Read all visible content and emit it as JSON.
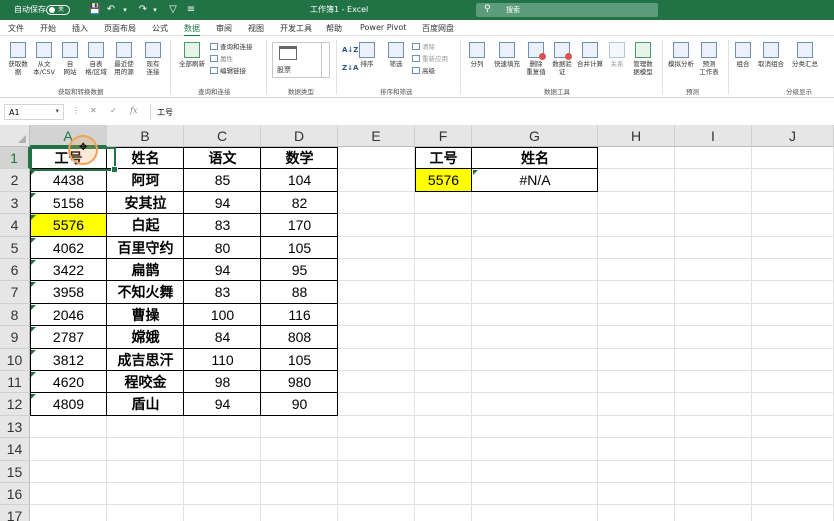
{
  "titlebar": {
    "autosave_label": "自动保存",
    "autosave_state": "关",
    "doc_title": "工作簿1 - Excel",
    "search_placeholder": "搜索",
    "icons": [
      "save-icon",
      "undo-icon",
      "redo-icon",
      "filter-icon",
      "customize-icon"
    ]
  },
  "menu": {
    "tabs": [
      "文件",
      "开始",
      "插入",
      "页面布局",
      "公式",
      "数据",
      "审阅",
      "视图",
      "开发工具",
      "帮助",
      "Power Pivot",
      "百度网盘"
    ],
    "active": "数据"
  },
  "ribbon": {
    "get_data": "获取数\n据",
    "from_text_csv": "从文\n本/CSV",
    "from_web": "自\n网站",
    "from_table": "自表\n格/区域",
    "recent_sources": "最近使\n用的源",
    "existing_conn": "现有\n连接",
    "group_get_transform": "获取和转换数据",
    "refresh_all": "全部刷新",
    "queries_conn": "查询和连接",
    "properties": "属性",
    "edit_links": "编辑链接",
    "group_queries": "查询和连接",
    "stock": "股票",
    "group_datatypes": "数据类型",
    "sort": "排序",
    "filter": "筛选",
    "clear": "清除",
    "reapply": "重新应用",
    "advanced": "高级",
    "group_sort_filter": "排序和筛选",
    "text_to_columns": "分列",
    "flash_fill": "快速填充",
    "remove_dup": "删除\n重复值",
    "data_validation": "数据验\n证",
    "consolidate": "合并计算",
    "relationships": "关系",
    "data_model": "管理数\n据模型",
    "group_data_tools": "数据工具",
    "whatif": "模拟分析",
    "forecast_sheet": "预测\n工作表",
    "group_forecast": "预测",
    "group_btn": "组合",
    "ungroup": "取消组合",
    "subtotal": "分类汇总",
    "group_outline": "分级显示"
  },
  "formula_bar": {
    "name_box": "A1",
    "formula": "工号"
  },
  "sheet": {
    "columns": [
      "A",
      "B",
      "C",
      "D",
      "E",
      "F",
      "G",
      "H",
      "I",
      "J"
    ],
    "rows": [
      "1",
      "2",
      "3",
      "4",
      "5",
      "6",
      "7",
      "8",
      "9",
      "10",
      "11",
      "12",
      "13",
      "14",
      "15",
      "16",
      "17"
    ],
    "headers": [
      "工号",
      "姓名",
      "语文",
      "数学"
    ],
    "data": [
      [
        "4438",
        "阿珂",
        "85",
        "104"
      ],
      [
        "5158",
        "安其拉",
        "94",
        "82"
      ],
      [
        "5576",
        "白起",
        "83",
        "170"
      ],
      [
        "4062",
        "百里守约",
        "80",
        "105"
      ],
      [
        "3422",
        "扁鹊",
        "94",
        "95"
      ],
      [
        "3958",
        "不知火舞",
        "83",
        "88"
      ],
      [
        "2046",
        "曹操",
        "100",
        "116"
      ],
      [
        "2787",
        "嫦娥",
        "84",
        "808"
      ],
      [
        "3812",
        "成吉思汗",
        "110",
        "105"
      ],
      [
        "4620",
        "程咬金",
        "98",
        "980"
      ],
      [
        "4809",
        "盾山",
        "94",
        "90"
      ]
    ],
    "lookup_headers": [
      "工号",
      "姓名"
    ],
    "lookup_values": [
      "5576",
      "#N/A"
    ],
    "highlight_color": "#ffff00",
    "accent": "#217346"
  }
}
